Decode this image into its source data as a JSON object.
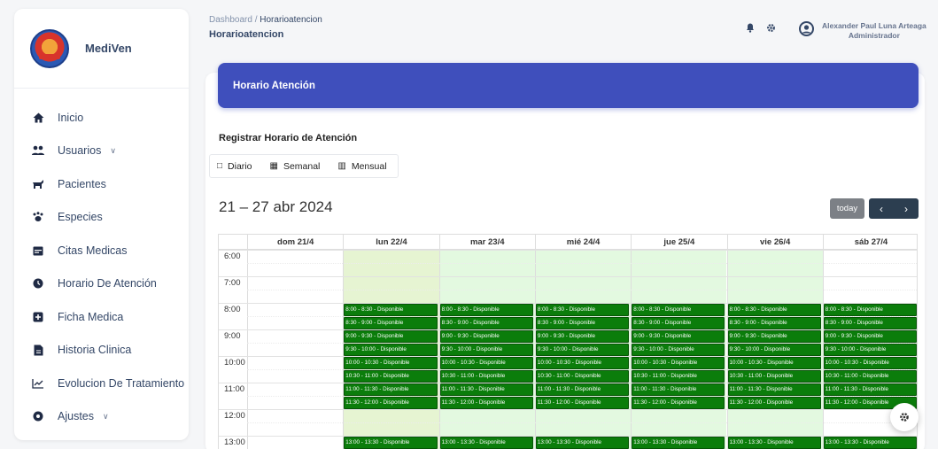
{
  "brand": {
    "name": "MediVen"
  },
  "sidebar": {
    "items": [
      {
        "label": "Inicio",
        "icon": "home-icon",
        "chevron": ""
      },
      {
        "label": "Usuarios",
        "icon": "users-icon",
        "chevron": "∨"
      },
      {
        "label": "Pacientes",
        "icon": "paw-animal-icon",
        "chevron": ""
      },
      {
        "label": "Especies",
        "icon": "paw-icon",
        "chevron": ""
      },
      {
        "label": "Citas Medicas",
        "icon": "calendar-icon",
        "chevron": ""
      },
      {
        "label": "Horario De Atención",
        "icon": "circle-icon",
        "chevron": ""
      },
      {
        "label": "Ficha Medica",
        "icon": "medical-plus-icon",
        "chevron": ""
      },
      {
        "label": "Historia Clinica",
        "icon": "document-icon",
        "chevron": ""
      },
      {
        "label": "Evolucion De Tratamiento",
        "icon": "chart-line-icon",
        "chevron": ""
      },
      {
        "label": "Ajustes",
        "icon": "settings-circle-icon",
        "chevron": "∨"
      }
    ]
  },
  "header": {
    "breadcrumb_root": "Dashboard",
    "breadcrumb_sep": "/",
    "breadcrumb_current": "Horarioatencion",
    "title": "Horarioatencion",
    "user_name": "Alexander Paul Luna Arteaga",
    "user_role": "Administrador"
  },
  "banner": {
    "title": "Horario Atención"
  },
  "form": {
    "title": "Registrar Horario de Atención"
  },
  "view_tabs": [
    {
      "label": "Diario",
      "icon": "□"
    },
    {
      "label": "Semanal",
      "icon": "▦"
    },
    {
      "label": "Mensual",
      "icon": "▥"
    }
  ],
  "calendar": {
    "range": "21 – 27 abr 2024",
    "today_label": "today",
    "prev_label": "‹",
    "next_label": "›",
    "days": [
      "dom 21/4",
      "lun 22/4",
      "mar 23/4",
      "mié 24/4",
      "jue 25/4",
      "vie 26/4",
      "sáb 27/4"
    ],
    "today_day_index": 1,
    "available_day_indices": [
      2,
      3,
      4,
      5
    ],
    "hours": [
      "6:00",
      "7:00",
      "8:00",
      "9:00",
      "10:00",
      "11:00",
      "12:00",
      "13:00"
    ],
    "slot_color": "#0b7d0b",
    "today_color": "#e6f4d2",
    "available_color": "#e3f9e0",
    "event_day_indices": [
      1,
      2,
      3,
      4,
      5,
      6
    ],
    "events": [
      {
        "label": "8:00 - 8:30 - Disponible",
        "start": 8.0
      },
      {
        "label": "8:30 - 9:00 - Disponible",
        "start": 8.5
      },
      {
        "label": "9:00 - 9:30 - Disponible",
        "start": 9.0
      },
      {
        "label": "9:30 - 10:00 - Disponible",
        "start": 9.5
      },
      {
        "label": "10:00 - 10:30 - Disponible",
        "start": 10.0
      },
      {
        "label": "10:30 - 11:00 - Disponible",
        "start": 10.5
      },
      {
        "label": "11:00 - 11:30 - Disponible",
        "start": 11.0
      },
      {
        "label": "11:30 - 12:00 - Disponible",
        "start": 11.5
      },
      {
        "label": "13:00 - 13:30 - Disponible",
        "start": 13.0
      }
    ]
  },
  "colors": {
    "accent": "#3f4fbc",
    "nav_dark": "#2c3e50",
    "today_btn": "#7c8086"
  }
}
